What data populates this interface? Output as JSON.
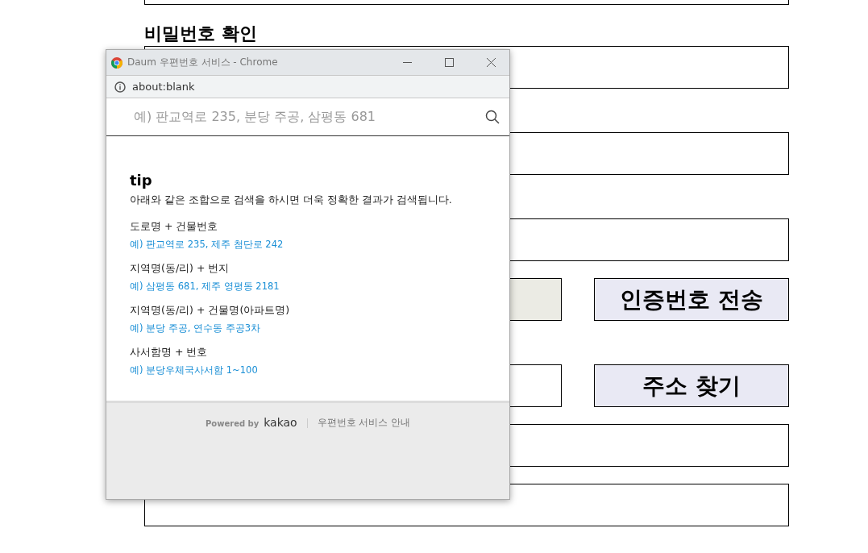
{
  "form": {
    "rows": [
      {
        "kind": "field",
        "disabled": false
      },
      {
        "kind": "heading",
        "text": "비밀번호 확인"
      },
      {
        "kind": "field",
        "disabled": false
      },
      {
        "kind": "field",
        "disabled": false
      },
      {
        "kind": "field",
        "disabled": false
      },
      {
        "kind": "field_button",
        "disabled": true,
        "button": "인증번호 전송"
      },
      {
        "kind": "field_button",
        "disabled": false,
        "button": "주소 찾기"
      },
      {
        "kind": "field",
        "disabled": false
      },
      {
        "kind": "field",
        "disabled": false
      }
    ]
  },
  "popup": {
    "title": "Daum 우편번호 서비스 - Chrome",
    "address": "about:blank",
    "search": {
      "placeholder": "예) 판교역로 235, 분당 주공, 삼평동 681"
    },
    "tip": {
      "title": "tip",
      "description": "아래와 같은 조합으로 검색을 하시면 더욱 정확한 결과가 검색됩니다.",
      "items": [
        {
          "label": "도로명 + 건물번호",
          "example": "예) 판교역로 235,  제주 첨단로 242"
        },
        {
          "label": "지역명(동/리) + 번지",
          "example": "예) 삼평동 681,  제주 영평동 2181"
        },
        {
          "label": "지역명(동/리) + 건물명(아파트명)",
          "example": "예) 분당 주공,  연수동 주공3차"
        },
        {
          "label": "사서함명 + 번호",
          "example": "예) 분당우체국사서함 1~100"
        }
      ]
    },
    "footer": {
      "powered_by": "Powered by",
      "brand": "kakao",
      "link": "우편번호 서비스 안내"
    }
  }
}
